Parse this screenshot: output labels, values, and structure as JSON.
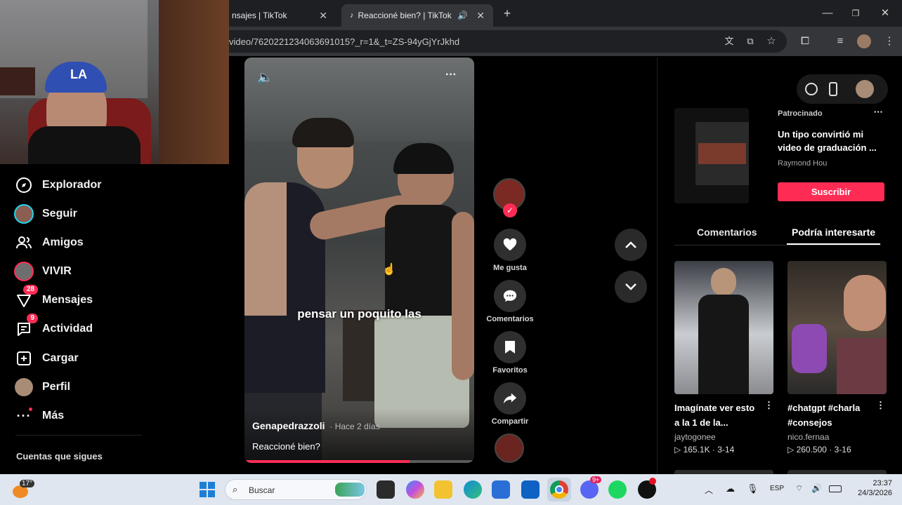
{
  "browser": {
    "tabs": [
      {
        "label": "nsajes | TikTok"
      },
      {
        "label": "Reaccioné bien? | TikTok"
      }
    ],
    "url": "video/7620221234063691015?_r=1&_t=ZS-94yGjYrJkhd"
  },
  "sidebar": {
    "items": [
      {
        "label": "Explorador",
        "icon": "compass-icon"
      },
      {
        "label": "Seguir",
        "icon": "avatar-icon"
      },
      {
        "label": "Amigos",
        "icon": "friends-icon"
      },
      {
        "label": "VIVIR",
        "icon": "live-icon"
      },
      {
        "label": "Mensajes",
        "icon": "messages-icon",
        "badge": "28"
      },
      {
        "label": "Actividad",
        "icon": "activity-icon",
        "badge": "9"
      },
      {
        "label": "Cargar",
        "icon": "upload-icon"
      },
      {
        "label": "Perfil",
        "icon": "profile-icon"
      },
      {
        "label": "Más",
        "icon": "more-icon"
      }
    ],
    "following_title": "Cuentas que sigues"
  },
  "video": {
    "caption_overlay": "pensar un poquito las",
    "author": "Genapedrazzoli",
    "time_ago": "· Hace 2 días",
    "description": "Reaccioné bien?",
    "progress": 0.72
  },
  "actions": {
    "like": "Me gusta",
    "comments": "Comentarios",
    "favorites": "Favoritos",
    "share": "Compartir"
  },
  "sponsored": {
    "tag": "Patrocinado",
    "title": "Un tipo convirtió mi video de graduación ...",
    "author": "Raymond Hou",
    "cta": "Suscribir"
  },
  "panel_tabs": {
    "comments": "Comentarios",
    "related": "Podría interesarte"
  },
  "related": [
    {
      "title": "Imagínate ver esto a la 1 de la...",
      "author": "jaytogonee",
      "stats": "165.1K · 3-14"
    },
    {
      "title": "#chatgpt #charla #consejos",
      "author": "nico.fernaa",
      "stats": "260.500 · 3-16"
    }
  ],
  "taskbar": {
    "temperature": "17°",
    "search_placeholder": "Buscar",
    "language": "ESP",
    "time": "23:37",
    "date": "24/3/2026",
    "discord_badge": "9+"
  }
}
